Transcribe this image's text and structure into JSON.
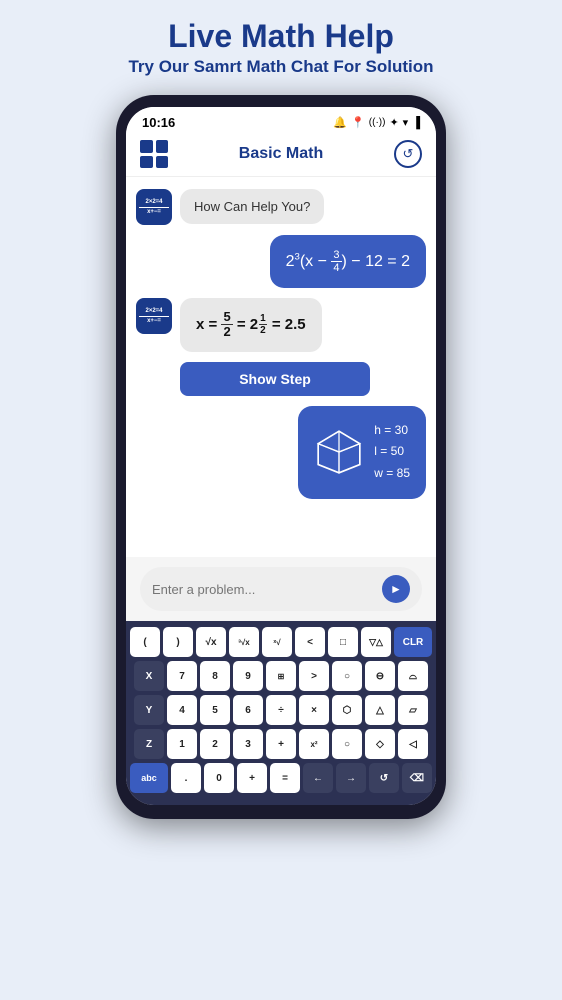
{
  "page": {
    "title": "Live Math Help",
    "subtitle": "Try Our Samrt Math Chat For Solution"
  },
  "status_bar": {
    "time": "10:16",
    "icons": [
      "🔔",
      "📍",
      "(()))",
      "✦",
      "▼",
      "▌"
    ]
  },
  "app_bar": {
    "title": "Basic Math"
  },
  "chat": {
    "welcome_message": "How Can Help You?",
    "user_equation": "2³(x - 3/4) - 12 = 2",
    "answer": "x = 5/2 = 2 1/2 = 2.5",
    "show_step_label": "Show Step",
    "cube_stats": "h = 30\nl = 50\nw = 85"
  },
  "input": {
    "placeholder": "Enter a problem..."
  },
  "keyboard": {
    "rows": [
      [
        "(",
        ")",
        "√x",
        "³√x",
        "ˣ√",
        "<",
        "□",
        "△▲",
        "CLR"
      ],
      [
        "X",
        "7",
        "8",
        "9",
        "⊞",
        ">",
        "○",
        "⊖",
        "⌓"
      ],
      [
        "Y",
        "4",
        "5",
        "6",
        "÷",
        "X",
        "⬡",
        "△",
        "▱"
      ],
      [
        "Z",
        "1",
        "2",
        "3",
        "+",
        "ˣ²",
        "○",
        "◇",
        "△"
      ],
      [
        "abc",
        ".",
        "0",
        "+",
        "=",
        "←",
        "→",
        "↺",
        "⌫"
      ]
    ]
  }
}
